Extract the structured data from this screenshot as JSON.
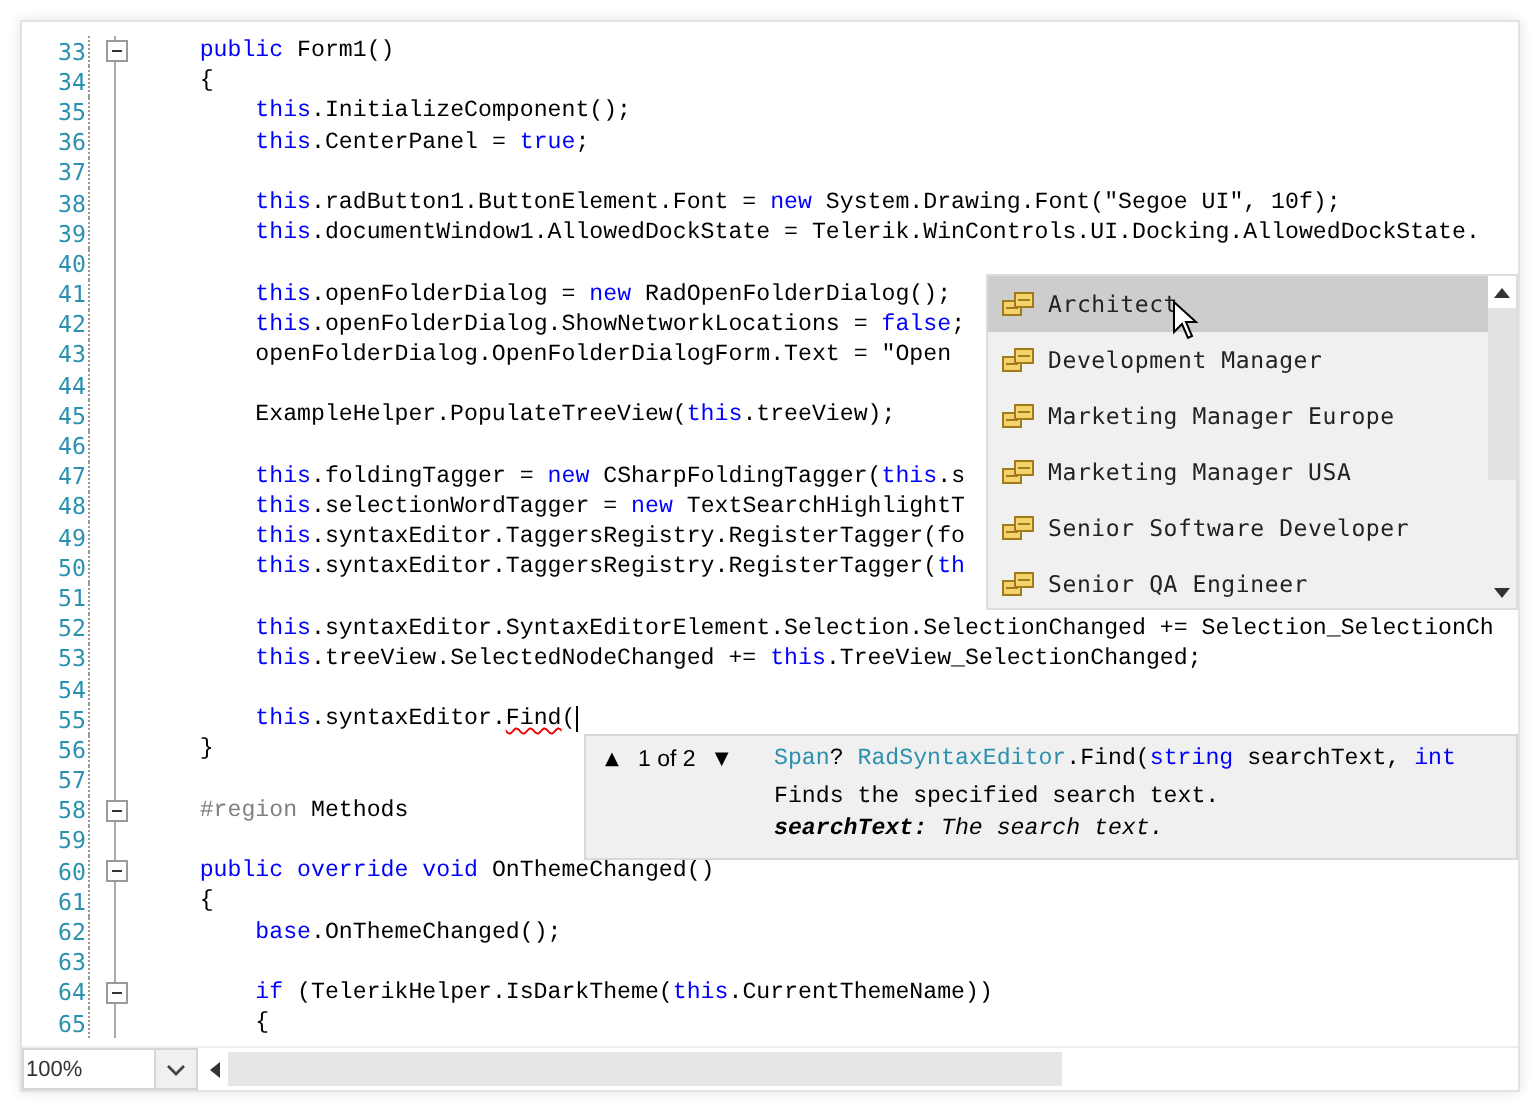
{
  "editor": {
    "lines": [
      {
        "number": "33",
        "fold": true,
        "caret": false,
        "segments": [
          {
            "kind": "keyword",
            "text": "    public"
          },
          {
            "kind": "plain",
            "text": " Form1()"
          }
        ]
      },
      {
        "number": "34",
        "fold": false,
        "caret": false,
        "segments": [
          {
            "kind": "plain",
            "text": "    {"
          }
        ]
      },
      {
        "number": "35",
        "fold": false,
        "caret": false,
        "segments": [
          {
            "kind": "keyword",
            "text": "        this"
          },
          {
            "kind": "plain",
            "text": ".InitializeComponent();"
          }
        ]
      },
      {
        "number": "36",
        "fold": false,
        "caret": false,
        "segments": [
          {
            "kind": "keyword",
            "text": "        this"
          },
          {
            "kind": "plain",
            "text": ".CenterPanel = "
          },
          {
            "kind": "keyword",
            "text": "true"
          },
          {
            "kind": "plain",
            "text": ";"
          }
        ]
      },
      {
        "number": "37",
        "fold": false,
        "caret": false
      },
      {
        "number": "38",
        "fold": false,
        "caret": false,
        "segments": [
          {
            "kind": "keyword",
            "text": "        this"
          },
          {
            "kind": "plain",
            "text": ".radButton1.ButtonElement.Font = "
          },
          {
            "kind": "keyword",
            "text": "new"
          },
          {
            "kind": "plain",
            "text": " System.Drawing.Font(\"Segoe UI\", 10f);"
          }
        ]
      },
      {
        "number": "39",
        "fold": false,
        "caret": false,
        "segments": [
          {
            "kind": "keyword",
            "text": "        this"
          },
          {
            "kind": "plain",
            "text": ".documentWindow1.AllowedDockState = Telerik.WinControls.UI.Docking.AllowedDockState."
          }
        ]
      },
      {
        "number": "40",
        "fold": false,
        "caret": false
      },
      {
        "number": "41",
        "fold": false,
        "caret": false,
        "segments": [
          {
            "kind": "keyword",
            "text": "        this"
          },
          {
            "kind": "plain",
            "text": ".openFolderDialog = "
          },
          {
            "kind": "keyword",
            "text": "new"
          },
          {
            "kind": "plain",
            "text": " RadOpenFolderDialog();"
          }
        ]
      },
      {
        "number": "42",
        "fold": false,
        "caret": false,
        "segments": [
          {
            "kind": "keyword",
            "text": "        this"
          },
          {
            "kind": "plain",
            "text": ".openFolderDialog.ShowNetworkLocations = "
          },
          {
            "kind": "keyword",
            "text": "false"
          },
          {
            "kind": "plain",
            "text": ";"
          }
        ]
      },
      {
        "number": "43",
        "fold": false,
        "caret": false,
        "segments": [
          {
            "kind": "plain",
            "text": "        openFolderDialog.OpenFolderDialogForm.Text = \"Open"
          }
        ]
      },
      {
        "number": "44",
        "fold": false,
        "caret": false
      },
      {
        "number": "45",
        "fold": false,
        "caret": false,
        "segments": [
          {
            "kind": "plain",
            "text": "        ExampleHelper.PopulateTreeView("
          },
          {
            "kind": "keyword",
            "text": "this"
          },
          {
            "kind": "plain",
            "text": ".treeView);"
          }
        ]
      },
      {
        "number": "46",
        "fold": false,
        "caret": false
      },
      {
        "number": "47",
        "fold": false,
        "caret": false,
        "segments": [
          {
            "kind": "keyword",
            "text": "        this"
          },
          {
            "kind": "plain",
            "text": ".foldingTagger = "
          },
          {
            "kind": "keyword",
            "text": "new"
          },
          {
            "kind": "plain",
            "text": " CSharpFoldingTagger("
          },
          {
            "kind": "keyword",
            "text": "this"
          },
          {
            "kind": "plain",
            "text": ".s"
          }
        ]
      },
      {
        "number": "48",
        "fold": false,
        "caret": false,
        "segments": [
          {
            "kind": "keyword",
            "text": "        this"
          },
          {
            "kind": "plain",
            "text": ".selectionWordTagger = "
          },
          {
            "kind": "keyword",
            "text": "new"
          },
          {
            "kind": "plain",
            "text": " TextSearchHighlightT"
          }
        ]
      },
      {
        "number": "49",
        "fold": false,
        "caret": false,
        "segments": [
          {
            "kind": "keyword",
            "text": "        this"
          },
          {
            "kind": "plain",
            "text": ".syntaxEditor.TaggersRegistry.RegisterTagger(fo"
          }
        ]
      },
      {
        "number": "50",
        "fold": false,
        "caret": false,
        "segments": [
          {
            "kind": "keyword",
            "text": "        this"
          },
          {
            "kind": "plain",
            "text": ".syntaxEditor.TaggersRegistry.RegisterTagger("
          },
          {
            "kind": "keyword",
            "text": "th"
          }
        ]
      },
      {
        "number": "51",
        "fold": false,
        "caret": false
      },
      {
        "number": "52",
        "fold": false,
        "caret": false,
        "segments": [
          {
            "kind": "keyword",
            "text": "        this"
          },
          {
            "kind": "plain",
            "text": ".syntaxEditor.SyntaxEditorElement.Selection.SelectionChanged += Selection_SelectionCh"
          }
        ]
      },
      {
        "number": "53",
        "fold": false,
        "caret": false,
        "segments": [
          {
            "kind": "keyword",
            "text": "        this"
          },
          {
            "kind": "plain",
            "text": ".treeView.SelectedNodeChanged += "
          },
          {
            "kind": "keyword",
            "text": "this"
          },
          {
            "kind": "plain",
            "text": ".TreeView_SelectionChanged;"
          }
        ]
      },
      {
        "number": "54",
        "fold": false,
        "caret": false
      },
      {
        "number": "55",
        "fold": false,
        "caret": true,
        "segments": [
          {
            "kind": "keyword",
            "text": "        this"
          },
          {
            "kind": "plain",
            "text": ".syntaxEditor."
          },
          {
            "kind": "error",
            "text": "Find"
          },
          {
            "kind": "plain",
            "text": "("
          }
        ]
      },
      {
        "number": "56",
        "fold": false,
        "caret": false,
        "segments": [
          {
            "kind": "plain",
            "text": "    }"
          }
        ]
      },
      {
        "number": "57",
        "fold": false,
        "caret": false
      },
      {
        "number": "58",
        "fold": true,
        "caret": false,
        "segments": [
          {
            "kind": "region",
            "text": "    #region"
          },
          {
            "kind": "plain",
            "text": " Methods"
          }
        ]
      },
      {
        "number": "59",
        "fold": false,
        "caret": false
      },
      {
        "number": "60",
        "fold": true,
        "caret": false,
        "segments": [
          {
            "kind": "keyword",
            "text": "    public override void"
          },
          {
            "kind": "plain",
            "text": " OnThemeChanged()"
          }
        ]
      },
      {
        "number": "61",
        "fold": false,
        "caret": false,
        "segments": [
          {
            "kind": "plain",
            "text": "    {"
          }
        ]
      },
      {
        "number": "62",
        "fold": false,
        "caret": false,
        "segments": [
          {
            "kind": "keyword",
            "text": "        base"
          },
          {
            "kind": "plain",
            "text": ".OnThemeChanged();"
          }
        ]
      },
      {
        "number": "63",
        "fold": false,
        "caret": false
      },
      {
        "number": "64",
        "fold": true,
        "caret": false,
        "segments": [
          {
            "kind": "keyword",
            "text": "        if"
          },
          {
            "kind": "plain",
            "text": " (TelerikHelper.IsDarkTheme("
          },
          {
            "kind": "keyword",
            "text": "this"
          },
          {
            "kind": "plain",
            "text": ".CurrentThemeName))"
          }
        ]
      },
      {
        "number": "65",
        "fold": false,
        "caret": false,
        "segments": [
          {
            "kind": "plain",
            "text": "        {"
          }
        ]
      }
    ]
  },
  "completion_list": {
    "items": [
      {
        "label": "Architect",
        "selected": true
      },
      {
        "label": "Development Manager",
        "selected": false
      },
      {
        "label": "Marketing Manager Europe",
        "selected": false
      },
      {
        "label": "Marketing Manager USA",
        "selected": false
      },
      {
        "label": "Senior Software Developer",
        "selected": false
      },
      {
        "label": "Senior QA Engineer",
        "selected": false
      }
    ]
  },
  "signature_help": {
    "previous": "▲",
    "counter": "1 of 2",
    "next": "▼",
    "signature": [
      {
        "kind": "type",
        "text": "Span"
      },
      {
        "kind": "plain",
        "text": "? "
      },
      {
        "kind": "type",
        "text": "RadSyntaxEditor"
      },
      {
        "kind": "plain",
        "text": ".Find("
      },
      {
        "kind": "keyword",
        "text": "string"
      },
      {
        "kind": "plain",
        "text": " searchText, "
      },
      {
        "kind": "keyword",
        "text": "int"
      }
    ],
    "description": "Finds the specified search text.",
    "parameter": "**searchText:** The search text."
  },
  "zoom": {
    "value": "100%"
  }
}
